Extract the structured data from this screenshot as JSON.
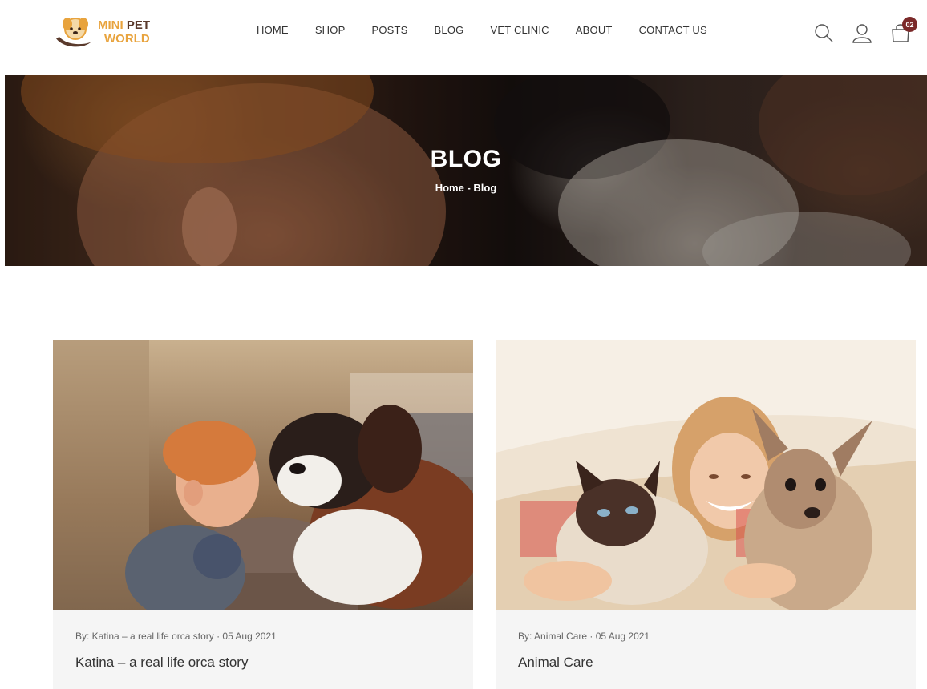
{
  "brand": {
    "line1_a": "MINI ",
    "line1_b": "PET",
    "line2": "WORLD"
  },
  "nav": {
    "items": [
      {
        "label": "HOME"
      },
      {
        "label": "SHOP"
      },
      {
        "label": "POSTS"
      },
      {
        "label": "BLOG"
      },
      {
        "label": "VET CLINIC"
      },
      {
        "label": "ABOUT"
      },
      {
        "label": "CONTACT US"
      }
    ]
  },
  "header_icons": {
    "search": "search-icon",
    "account": "user-icon",
    "cart": "shopping-bag-icon",
    "cart_count": "02"
  },
  "hero": {
    "title": "BLOG",
    "breadcrumb_home": "Home",
    "breadcrumb_sep": " - ",
    "breadcrumb_current": "Blog"
  },
  "posts": [
    {
      "meta": "By: Katina – a real life orca story · 05 Aug 2021",
      "title": "Katina – a real life orca story",
      "image": "toddler-with-saint-bernard-dog"
    },
    {
      "meta": "By: Animal Care · 05 Aug 2021",
      "title": "Animal Care",
      "image": "girl-hugging-cat-and-dog"
    }
  ],
  "colors": {
    "accent": "#e8a33d",
    "brand_dark": "#5a3a2c",
    "badge": "#7b2a2a",
    "card_bg": "#f5f5f5"
  }
}
